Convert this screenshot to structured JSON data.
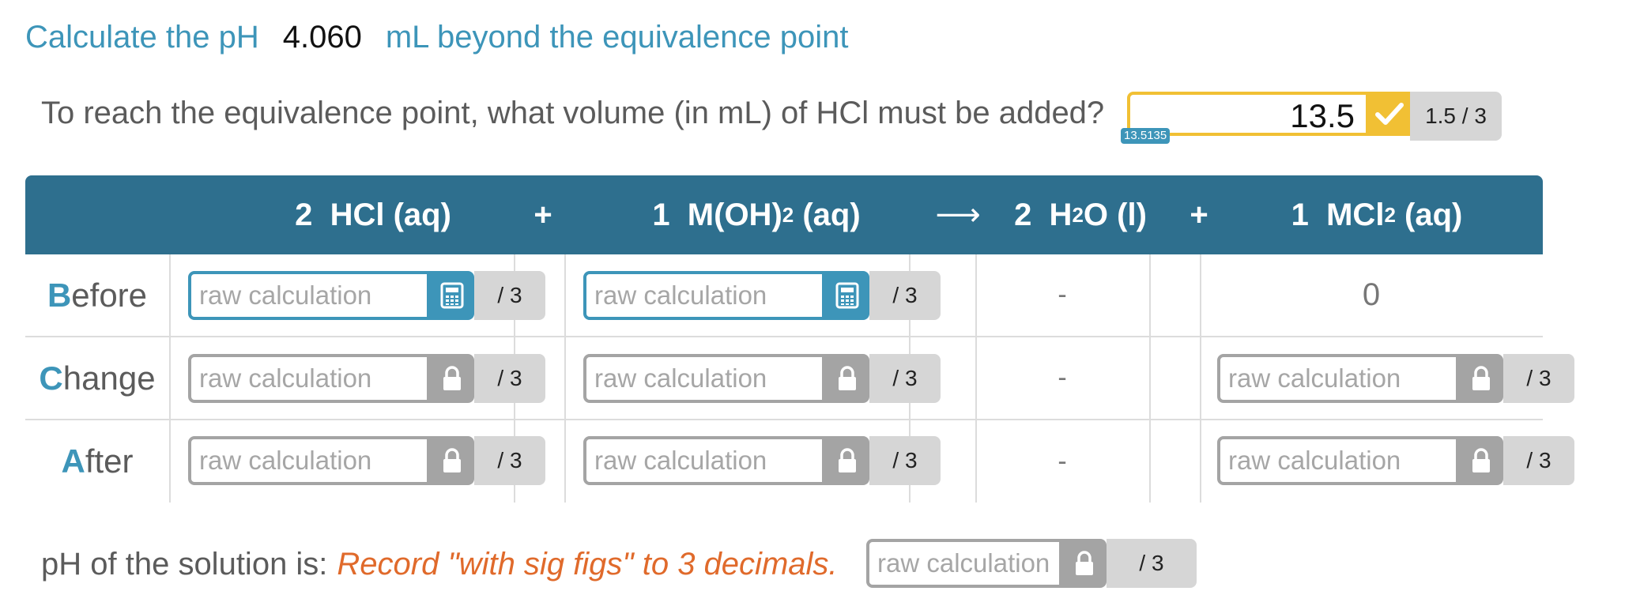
{
  "heading": {
    "prefix": "Calculate the pH",
    "value": "4.060",
    "suffix": "mL beyond the equivalence point"
  },
  "question": {
    "text": "To reach the equivalence point, what volume (in mL) of HCl must be added?",
    "answer": "13.5",
    "hint": "13.5135",
    "score": "1.5 / 3",
    "status_icon": "check-icon",
    "accent_color": "#f1c034"
  },
  "table": {
    "header": {
      "col1": {
        "coef": "2",
        "species": "HCl",
        "state": "(aq)"
      },
      "plus1": "+",
      "col2": {
        "coef": "1",
        "species_pre": "M(OH)",
        "sub": "2",
        "state": "(aq)"
      },
      "arrow": "⟶",
      "col3": {
        "coef": "2",
        "species_pre": "H",
        "sub": "2",
        "species_post": "O",
        "state": "(l)"
      },
      "plus2": "+",
      "col4": {
        "coef": "1",
        "species_pre": "MCl",
        "sub": "2",
        "state": "(aq)"
      }
    },
    "rows": [
      {
        "label_cap": "B",
        "label_rest": "efore"
      },
      {
        "label_cap": "C",
        "label_rest": "hange"
      },
      {
        "label_cap": "A",
        "label_rest": "fter"
      }
    ],
    "dash": "-",
    "mcl2_before": "0",
    "placeholder": "raw calculation",
    "score": "/ 3"
  },
  "footer": {
    "label": "pH of the solution is:",
    "note": "Record \"with sig figs\" to 3 decimals.",
    "placeholder": "raw calculation",
    "score": "/ 3"
  },
  "colors": {
    "header_bg": "#2e6f8e",
    "accent_blue": "#3d95b9",
    "note_orange": "#e06a2b"
  }
}
